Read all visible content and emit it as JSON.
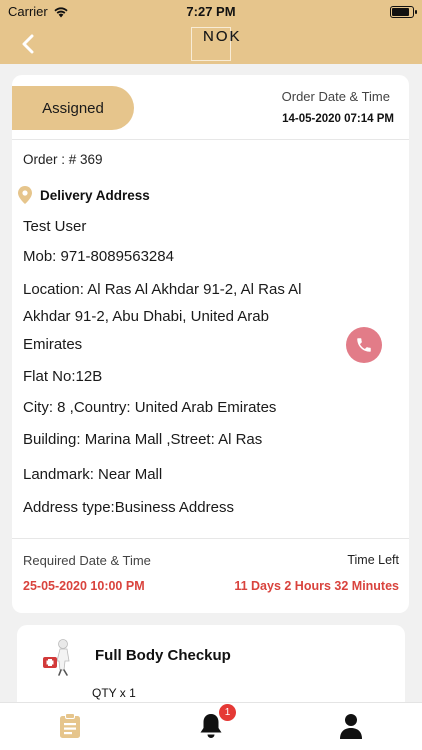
{
  "status_bar": {
    "carrier": "Carrier",
    "time": "7:27 PM"
  },
  "nav": {
    "logo_line1": "NOK",
    "logo_line2": "NOK"
  },
  "order": {
    "status": "Assigned",
    "date_label": "Order Date & Time",
    "date_value": "14-05-2020 07:14 PM",
    "order_number": "Order : # 369",
    "address_title": "Delivery Address",
    "name": "Test User",
    "mobile": "Mob: 971-8089563284",
    "location_line1": "Location: Al Ras Al Akhdar 91-2, Al Ras Al",
    "location_line2": "Akhdar 91-2, Abu Dhabi, United Arab",
    "location_line3": "Emirates",
    "flat": "Flat No:12B",
    "city": "City: 8 ,Country: United Arab Emirates",
    "building": "Building: Marina Mall ,Street: Al Ras",
    "landmark": "Landmark: Near Mall",
    "address_type": "Address type:Business Address",
    "required_label": "Required Date & Time",
    "required_value": "25-05-2020 10:00 PM",
    "time_left_label": "Time Left",
    "time_left_value": "11 Days 2 Hours 32 Minutes"
  },
  "item": {
    "name": "Full Body Checkup",
    "qty": "QTY x 1"
  },
  "tabs": {
    "notification_count": "1"
  },
  "colors": {
    "accent": "#e6c58c",
    "alert": "#d9433d",
    "call": "#e27c88"
  }
}
